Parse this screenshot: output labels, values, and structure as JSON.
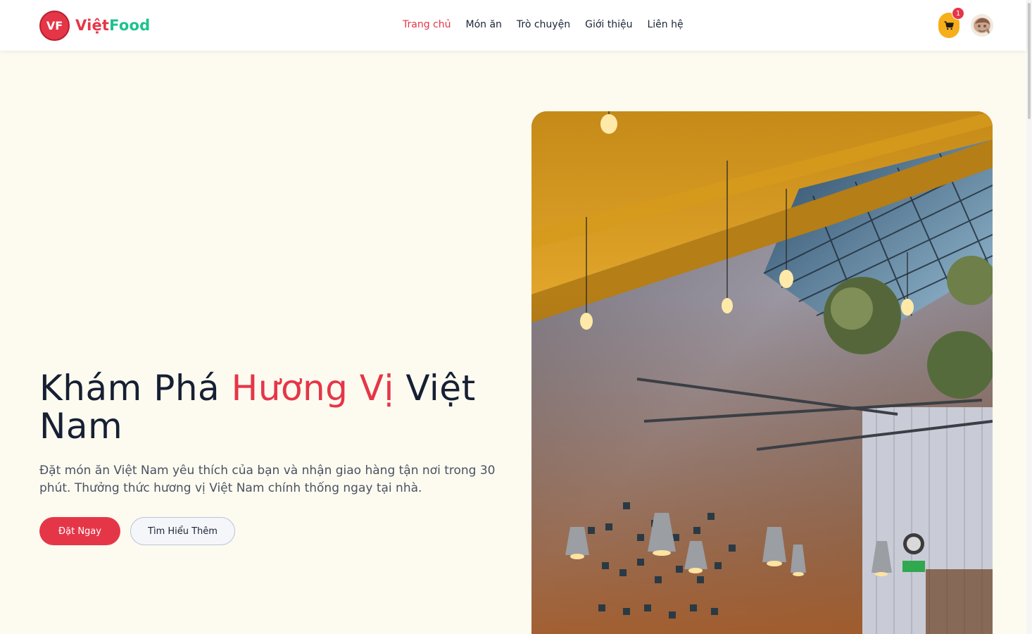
{
  "header": {
    "logo_initials": "VF",
    "brand_part1": "Việt",
    "brand_part2": "Food",
    "nav": [
      {
        "label": "Trang chủ",
        "active": true
      },
      {
        "label": "Món ăn",
        "active": false
      },
      {
        "label": "Trò chuyện",
        "active": false
      },
      {
        "label": "Giới thiệu",
        "active": false
      },
      {
        "label": "Liên hệ",
        "active": false
      }
    ],
    "cart_count": "1",
    "cart_icon": "shopping-cart-icon",
    "avatar_icon": "user-avatar"
  },
  "hero": {
    "title_part1": "Khám Phá",
    "title_accent": "Hương Vị",
    "title_part2": "Việt Nam",
    "description": "Đặt món ăn Việt Nam yêu thích của bạn và nhận giao hàng tận nơi trong 30 phút. Thưởng thức hương vị Việt Nam chính thống ngay tại nhà.",
    "primary_button": "Đặt Ngay",
    "secondary_button": "Tìm Hiểu Thêm",
    "image_icon": "restaurant-interior-photo"
  },
  "colors": {
    "accent": "#e53648",
    "brand_green": "#1cc28d",
    "cart": "#f6ae1a",
    "background": "#fdfbf0"
  }
}
